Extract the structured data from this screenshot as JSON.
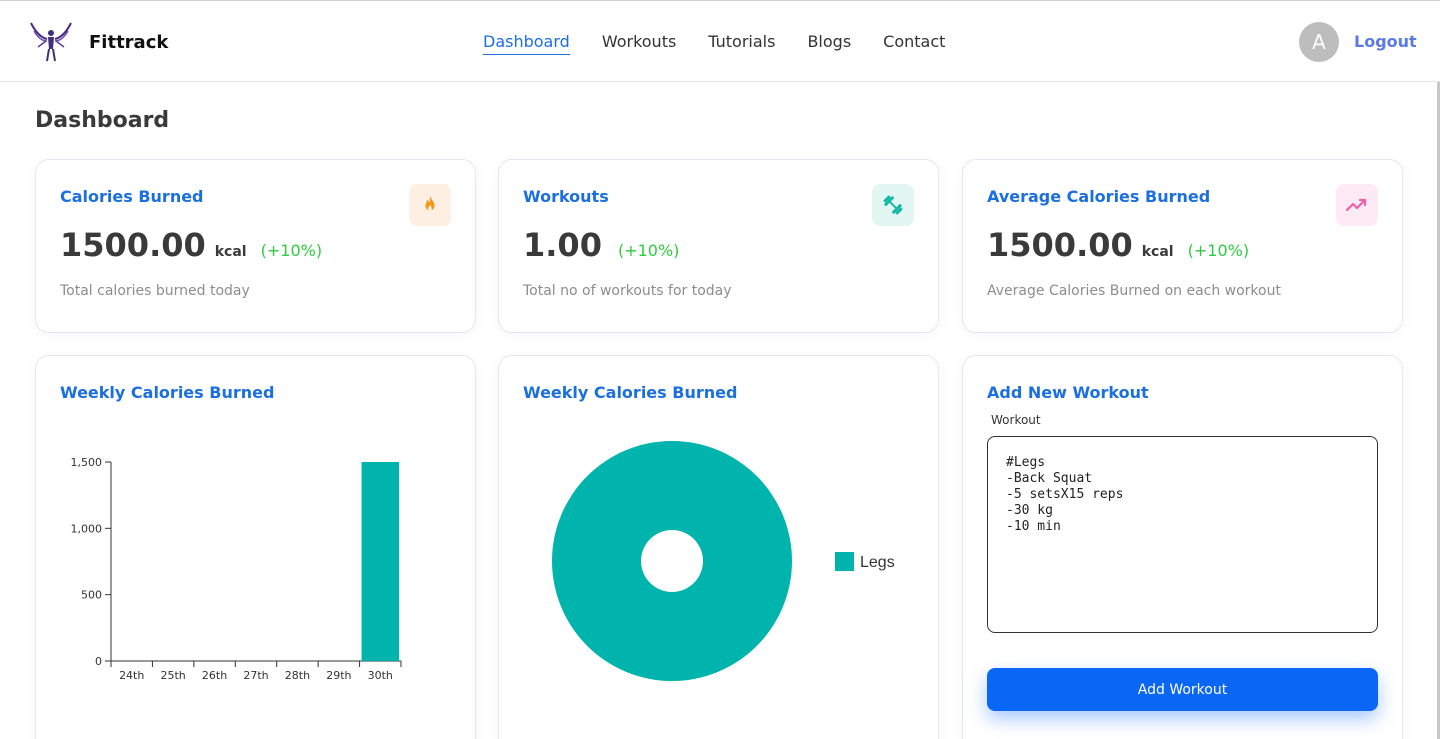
{
  "header": {
    "brand": "Fittrack",
    "nav": [
      {
        "label": "Dashboard",
        "active": true
      },
      {
        "label": "Workouts",
        "active": false
      },
      {
        "label": "Tutorials",
        "active": false
      },
      {
        "label": "Blogs",
        "active": false
      },
      {
        "label": "Contact",
        "active": false
      }
    ],
    "avatar_initial": "A",
    "logout_label": "Logout"
  },
  "page": {
    "title": "Dashboard"
  },
  "stats": [
    {
      "title": "Calories Burned",
      "value": "1500.00",
      "unit": "kcal",
      "change": "(+10%)",
      "description": "Total calories burned today",
      "icon": "fire-icon",
      "icon_color": "#ef9a1a",
      "icon_bg": "#fdf0e2"
    },
    {
      "title": "Workouts",
      "value": "1.00",
      "unit": "",
      "change": "(+10%)",
      "description": "Total no of workouts for today",
      "icon": "dumbbell-icon",
      "icon_color": "#14b8a6",
      "icon_bg": "#e3f6f3"
    },
    {
      "title": "Average Calories Burned",
      "value": "1500.00",
      "unit": "kcal",
      "change": "(+10%)",
      "description": "Average Calories Burned on each workout",
      "icon": "trending-up-icon",
      "icon_color": "#ec5fa8",
      "icon_bg": "#fdeaf4"
    }
  ],
  "bar_card": {
    "title": "Weekly Calories Burned"
  },
  "pie_card": {
    "title": "Weekly Calories Burned"
  },
  "chart_data": [
    {
      "type": "bar",
      "title": "Weekly Calories Burned",
      "categories": [
        "24th",
        "25th",
        "26th",
        "27th",
        "28th",
        "29th",
        "30th"
      ],
      "values": [
        0,
        0,
        0,
        0,
        0,
        0,
        1500
      ],
      "ylim": [
        0,
        1500
      ],
      "yticks": [
        0,
        500,
        1000,
        1500
      ],
      "ytick_labels": [
        "0",
        "500",
        "1,000",
        "1,500"
      ],
      "color": "#00b4ae",
      "grid": false
    },
    {
      "type": "pie",
      "title": "Weekly Calories Burned",
      "donut": true,
      "labels": [
        "Legs"
      ],
      "values": [
        1500
      ],
      "colors": [
        "#00b4ae"
      ],
      "legend_position": "right"
    }
  ],
  "add_workout": {
    "title": "Add New Workout",
    "field_label": "Workout",
    "value": "#Legs\n-Back Squat\n-5 setsX15 reps\n-30 kg\n-10 min",
    "button_label": "Add Workout"
  }
}
